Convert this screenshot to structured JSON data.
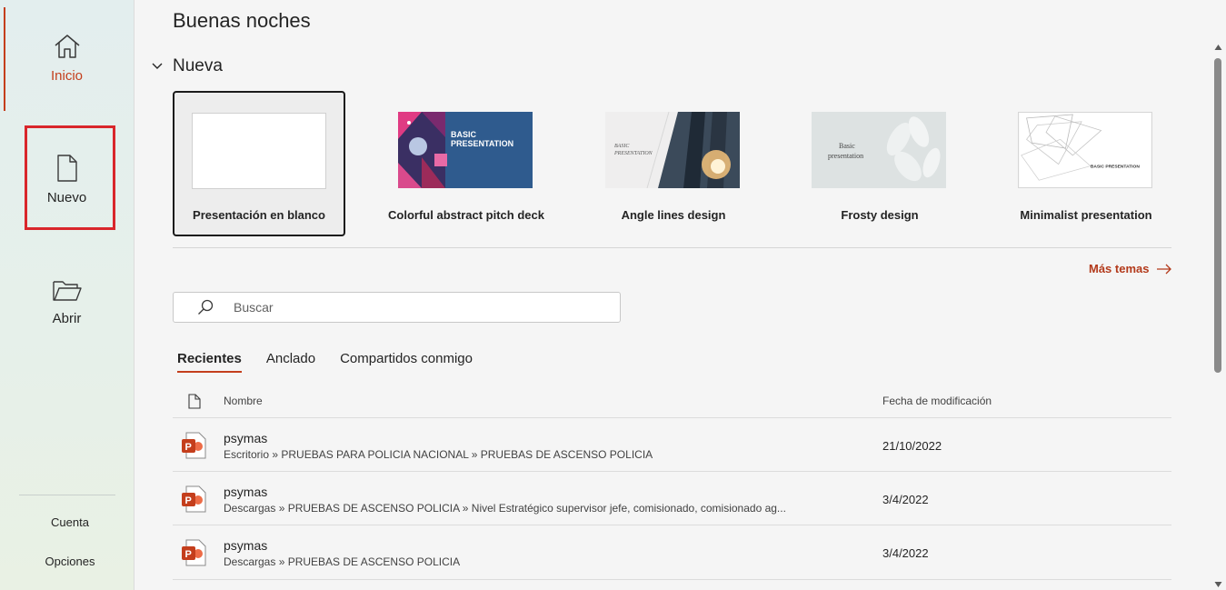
{
  "sidebar": {
    "items": [
      {
        "label": "Inicio",
        "icon": "home-icon"
      },
      {
        "label": "Nuevo",
        "icon": "new-document-icon"
      },
      {
        "label": "Abrir",
        "icon": "open-folder-icon"
      }
    ],
    "account": "Cuenta",
    "options": "Opciones"
  },
  "main": {
    "greeting": "Buenas noches",
    "new_section": "Nueva",
    "templates": [
      {
        "name": "Presentación en blanco"
      },
      {
        "name": "Colorful abstract pitch deck",
        "thumb_text": "BASIC PRESENTATION"
      },
      {
        "name": "Angle lines design",
        "thumb_text": "BASIC PRESENTATION"
      },
      {
        "name": "Frosty design",
        "thumb_text": "Basic presentation"
      },
      {
        "name": "Minimalist presentation",
        "thumb_text": "BASIC PRESENTATION"
      }
    ],
    "more_themes": "Más temas",
    "search_placeholder": "Buscar",
    "tabs": [
      "Recientes",
      "Anclado",
      "Compartidos conmigo"
    ],
    "columns": {
      "name": "Nombre",
      "modified": "Fecha de modificación"
    },
    "files": [
      {
        "name": "psymas",
        "path": "Escritorio » PRUEBAS PARA POLICIA NACIONAL » PRUEBAS DE ASCENSO POLICIA",
        "date": "21/10/2022"
      },
      {
        "name": "psymas",
        "path": "Descargas » PRUEBAS DE ASCENSO POLICIA » Nivel Estratégico supervisor jefe, comisionado, comisionado ag...",
        "date": "3/4/2022"
      },
      {
        "name": "psymas",
        "path": "Descargas » PRUEBAS DE ASCENSO POLICIA",
        "date": "3/4/2022"
      }
    ]
  },
  "colors": {
    "accent": "#c43e1c",
    "highlight_box": "#d9262b",
    "ppt": "#c43e1c"
  }
}
